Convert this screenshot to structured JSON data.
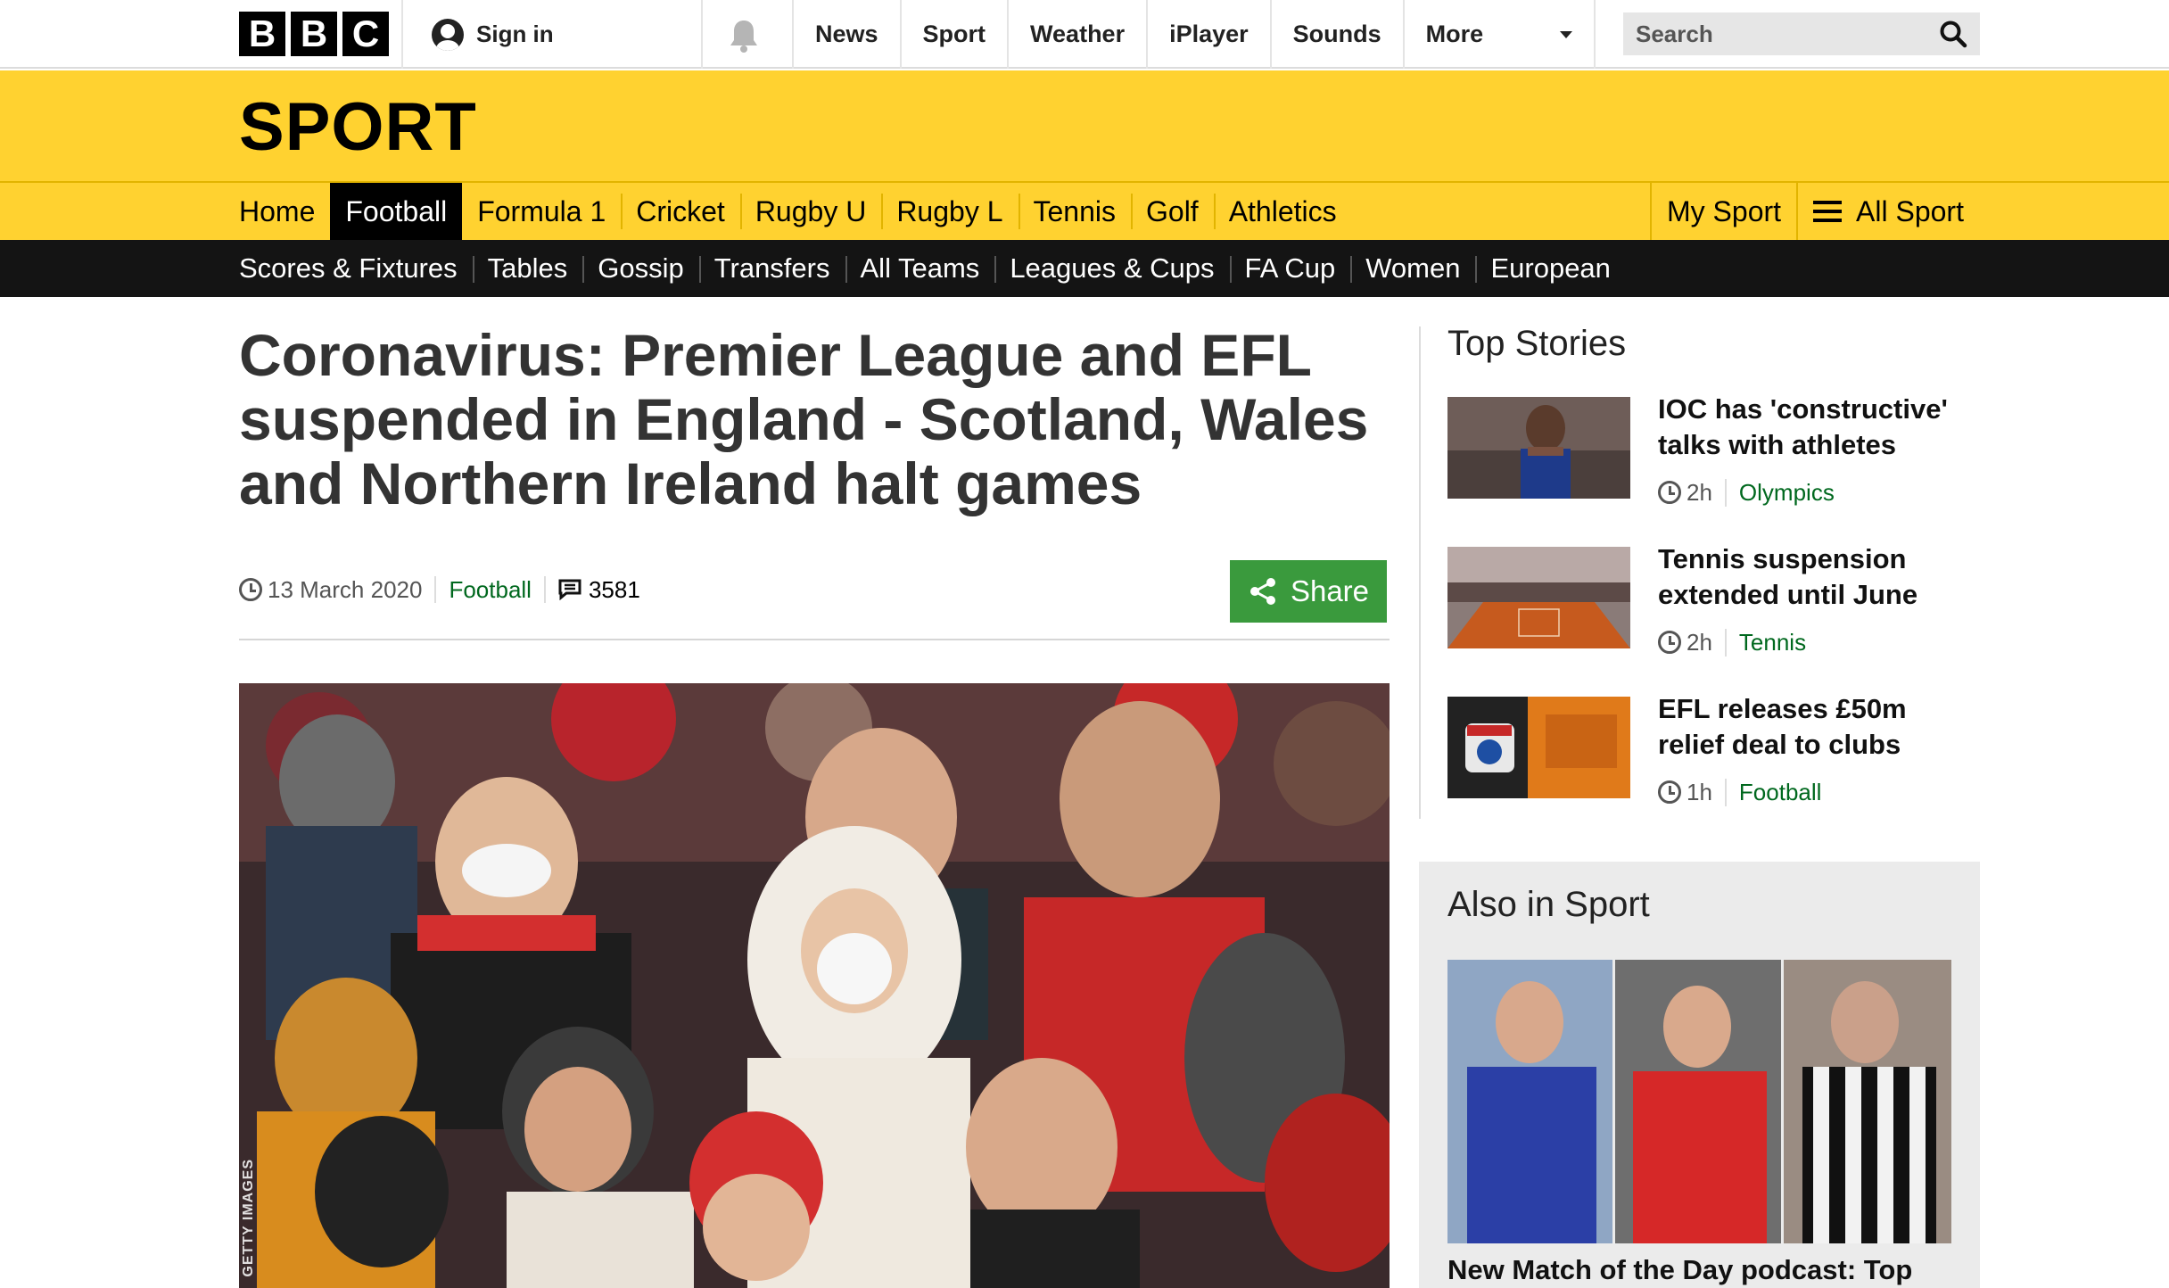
{
  "global_nav": {
    "logo_letters": [
      "B",
      "B",
      "C"
    ],
    "sign_in": "Sign in",
    "links": [
      "News",
      "Sport",
      "Weather",
      "iPlayer",
      "Sounds"
    ],
    "more": "More",
    "search_placeholder": "Search"
  },
  "sport_header": {
    "title": "SPORT",
    "nav": [
      "Home",
      "Football",
      "Formula 1",
      "Cricket",
      "Rugby U",
      "Rugby L",
      "Tennis",
      "Golf",
      "Athletics"
    ],
    "active": "Football",
    "my_sport": "My Sport",
    "all_sport": "All Sport"
  },
  "sub_nav": [
    "Scores & Fixtures",
    "Tables",
    "Gossip",
    "Transfers",
    "All Teams",
    "Leagues & Cups",
    "FA Cup",
    "Women",
    "European"
  ],
  "article": {
    "headline": "Coronavirus: Premier League and EFL suspended in England - Scotland, Wales and Northern Ireland halt games",
    "date": "13 March 2020",
    "section": "Football",
    "comment_count": "3581",
    "share_label": "Share",
    "image_credit": "GETTY IMAGES"
  },
  "top_stories": {
    "title": "Top Stories",
    "items": [
      {
        "title": "IOC has 'constructive' talks with athletes",
        "time": "2h",
        "section": "Olympics"
      },
      {
        "title": "Tennis suspension extended until June",
        "time": "2h",
        "section": "Tennis"
      },
      {
        "title": "EFL releases £50m relief deal to clubs",
        "time": "1h",
        "section": "Football"
      }
    ]
  },
  "also_in_sport": {
    "title": "Also in Sport",
    "headline": "New Match of the Day podcast: Top"
  },
  "colors": {
    "sport_yellow": "#ffd230",
    "link_green": "#00681e",
    "share_green": "#3a9a3d",
    "subnav_black": "#141414"
  }
}
